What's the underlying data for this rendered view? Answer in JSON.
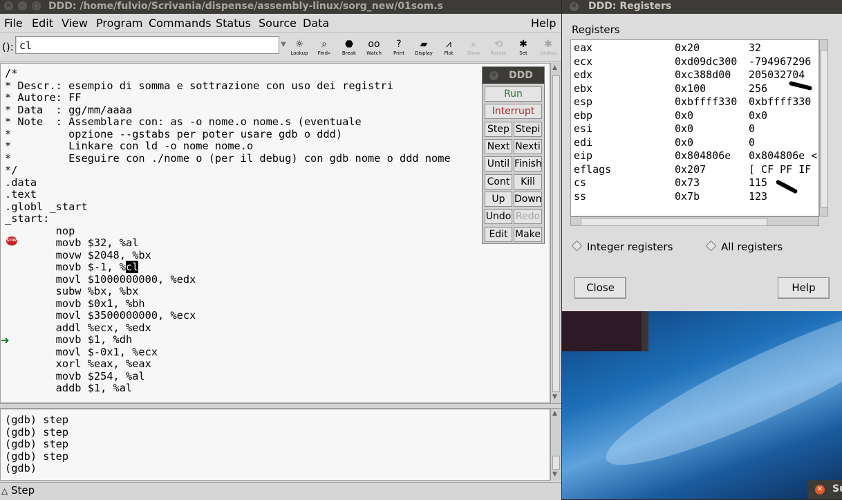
{
  "main_window": {
    "title": "DDD: /home/fulvio/Scrivania/dispense/assembly-linux/sorg_new/01som.s",
    "menu": [
      "File",
      "Edit",
      "View",
      "Program",
      "Commands",
      "Status",
      "Source",
      "Data"
    ],
    "help_menu": "Help",
    "arg_label": "():",
    "arg_value": "cl",
    "toolbar": [
      {
        "label": "Lookup",
        "icon": "lookup-icon",
        "glyph": "☼"
      },
      {
        "label": "Find»",
        "icon": "find-icon",
        "glyph": "⌕"
      },
      {
        "label": "Break",
        "icon": "stop-sign-icon",
        "glyph": "⬣"
      },
      {
        "label": "Watch",
        "icon": "watch-icon",
        "glyph": "oo"
      },
      {
        "label": "Print",
        "icon": "print-icon",
        "glyph": "?"
      },
      {
        "label": "Display",
        "icon": "display-icon",
        "glyph": "▰"
      },
      {
        "label": "Plot",
        "icon": "plot-icon",
        "glyph": "⩘"
      },
      {
        "label": "Show",
        "icon": "show-icon",
        "glyph": "⌕"
      },
      {
        "label": "Rotate",
        "icon": "rotate-icon",
        "glyph": "⟲"
      },
      {
        "label": "Set",
        "icon": "set-icon",
        "glyph": "✱"
      },
      {
        "label": "Undisp",
        "icon": "undisplay-icon",
        "glyph": "✱"
      }
    ],
    "source_lines": [
      "/*",
      "* Descr.: esempio di somma e sottrazione con uso dei registri",
      "* Autore: FF",
      "* Data  : gg/mm/aaaa",
      "* Note  : Assemblare con: as -o nome.o nome.s (eventuale",
      "*         opzione --gstabs per poter usare gdb o ddd)",
      "*         Linkare con ld -o nome nome.o",
      "*         Eseguire con ./nome o (per il debug) con gdb nome o ddd nome",
      "*/",
      ".data",
      ".text",
      ".globl _start",
      "_start:",
      "        nop",
      "        movb $32, %al",
      "        movw $2048, %bx",
      "        movb $-1, %",
      "        movl $1000000000, %edx",
      "        subw %bx, %bx",
      "        movb $0x1, %bh",
      "        movl $3500000000, %ecx",
      "        addl %ecx, %edx",
      "        movb $1, %dh",
      "        movl $-0x1, %ecx",
      "        xorl %eax, %eax",
      "        movb $254, %al",
      "        addb $1, %al"
    ],
    "selected_token": "cl",
    "breakpoint_icon_text": "STOP",
    "console_lines": [
      "(gdb) step",
      "(gdb) step",
      "(gdb) step",
      "(gdb) step",
      "(gdb)"
    ],
    "status_text": "Step"
  },
  "command_tool": {
    "title": "DDD",
    "run": "Run",
    "interrupt": "Interrupt",
    "pairs": [
      [
        "Step",
        "Stepi"
      ],
      [
        "Next",
        "Nexti"
      ],
      [
        "Until",
        "Finish"
      ],
      [
        "Cont",
        "Kill"
      ],
      [
        "Up",
        "Down"
      ],
      [
        "Undo",
        "Redo"
      ],
      [
        "Edit",
        "Make"
      ]
    ],
    "disabled": [
      "Redo"
    ]
  },
  "registers_window": {
    "title": "DDD: Registers",
    "section_label": "Registers",
    "registers": [
      {
        "name": "eax",
        "hex": "0x20",
        "value": "32"
      },
      {
        "name": "ecx",
        "hex": "0xd09dc300",
        "value": "-794967296"
      },
      {
        "name": "edx",
        "hex": "0xc388d00",
        "value": "205032704"
      },
      {
        "name": "ebx",
        "hex": "0x100",
        "value": "256"
      },
      {
        "name": "esp",
        "hex": "0xbffff330",
        "value": "0xbffff330"
      },
      {
        "name": "ebp",
        "hex": "0x0",
        "value": "0x0"
      },
      {
        "name": "esi",
        "hex": "0x0",
        "value": "0"
      },
      {
        "name": "edi",
        "hex": "0x0",
        "value": "0"
      },
      {
        "name": "eip",
        "hex": "0x804806e",
        "value": "0x804806e <"
      },
      {
        "name": "eflags",
        "hex": "0x207",
        "value": "[ CF PF IF"
      },
      {
        "name": "cs",
        "hex": "0x73",
        "value": "115"
      },
      {
        "name": "ss",
        "hex": "0x7b",
        "value": "123"
      }
    ],
    "radio_integer": "Integer registers",
    "radio_all": "All registers",
    "close_button": "Close",
    "help_button": "Help"
  },
  "taskbar_item": "Su"
}
